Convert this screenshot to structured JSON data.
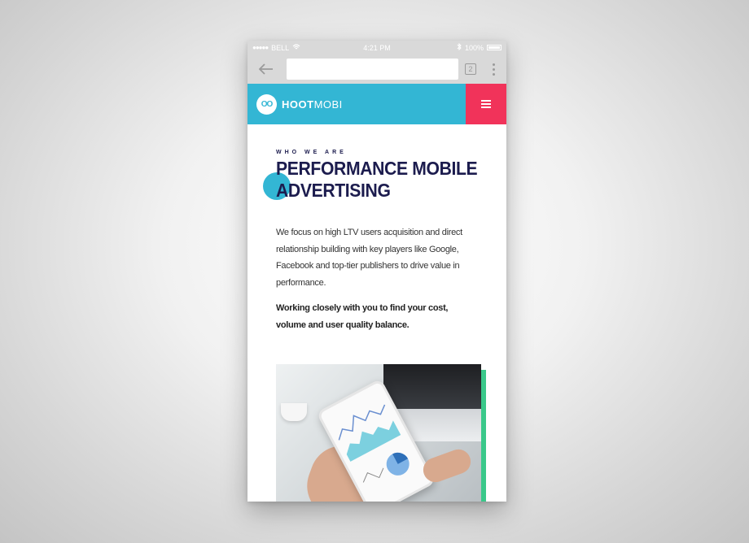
{
  "status_bar": {
    "signal": "●●●●●",
    "carrier": "BELL",
    "time": "4:21 PM",
    "battery": "100%"
  },
  "browser": {
    "url_value": "",
    "tab_count": "2"
  },
  "site_header": {
    "logo_mark": "OO",
    "logo_bold": "HOOT",
    "logo_light": "MOBI",
    "brand_color": "#33b6d4",
    "menu_color": "#f1335a"
  },
  "hero": {
    "eyebrow": "WHO WE ARE",
    "headline_line1": "PERFORMANCE MOBILE",
    "headline_line2": "ADVERTISING",
    "paragraph": "We focus on high LTV users acquisition and direct relationship building with key players like Google, Facebook and top-tier publishers to drive value in performance.",
    "emphasis": "Working closely with you to find your cost, volume and user quality balance."
  },
  "colors": {
    "headline": "#1c1c4e",
    "accent_bar": "#3ac88a"
  }
}
